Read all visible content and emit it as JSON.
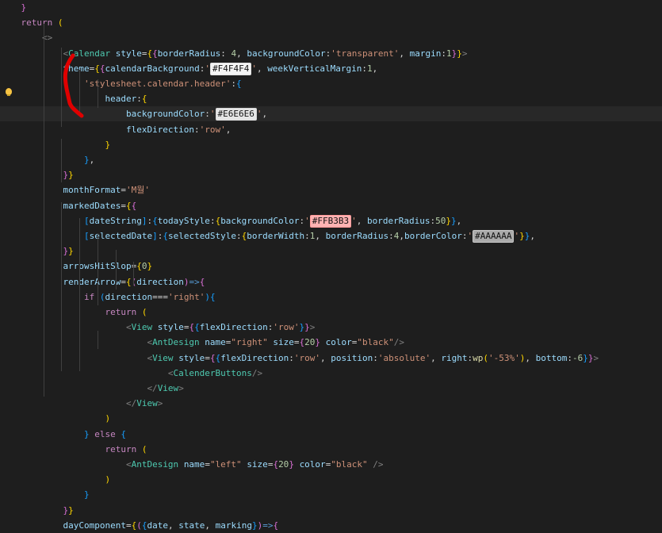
{
  "editor": {
    "lines": [
      [
        {
          "t": "    }",
          "c": "t-p2"
        }
      ],
      [
        {
          "t": "    return ",
          "c": "t-k"
        },
        {
          "t": "(",
          "c": "t-p1"
        }
      ],
      [
        {
          "t": "        ",
          "c": ""
        },
        {
          "t": "<>",
          "c": "t-br"
        }
      ],
      [
        {
          "t": "            ",
          "c": ""
        },
        {
          "t": "<",
          "c": "t-br"
        },
        {
          "t": "Calendar",
          "c": "t-tag"
        },
        {
          "t": " ",
          "c": ""
        },
        {
          "t": "style",
          "c": "t-v"
        },
        {
          "t": "=",
          "c": ""
        },
        {
          "t": "{",
          "c": "t-p1"
        },
        {
          "t": "{",
          "c": "t-p2"
        },
        {
          "t": "borderRadius",
          "c": "t-v"
        },
        {
          "t": ": ",
          "c": ""
        },
        {
          "t": "4",
          "c": "t-n"
        },
        {
          "t": ", ",
          "c": ""
        },
        {
          "t": "backgroundColor",
          "c": "t-v"
        },
        {
          "t": ":",
          "c": ""
        },
        {
          "t": "'transparent'",
          "c": "t-s"
        },
        {
          "t": ", ",
          "c": ""
        },
        {
          "t": "margin",
          "c": "t-v"
        },
        {
          "t": ":",
          "c": ""
        },
        {
          "t": "1",
          "c": "t-n"
        },
        {
          "t": "}",
          "c": "t-p2"
        },
        {
          "t": "}",
          "c": "t-p1"
        },
        {
          "t": ">",
          "c": "t-br"
        }
      ],
      [
        {
          "t": "            ",
          "c": ""
        },
        {
          "t": "theme",
          "c": "t-v"
        },
        {
          "t": "=",
          "c": ""
        },
        {
          "t": "{",
          "c": "t-p1"
        },
        {
          "t": "{",
          "c": "t-p2"
        },
        {
          "t": "calendarBackground",
          "c": "t-v"
        },
        {
          "t": ":",
          "c": ""
        },
        {
          "t": "'",
          "c": "t-s"
        },
        {
          "t": "#F4F4F4",
          "c": "swatch sw-lighter"
        },
        {
          "t": "'",
          "c": "t-s"
        },
        {
          "t": ", ",
          "c": ""
        },
        {
          "t": "weekVerticalMargin",
          "c": "t-v"
        },
        {
          "t": ":",
          "c": ""
        },
        {
          "t": "1",
          "c": "t-n"
        },
        {
          "t": ",",
          "c": ""
        }
      ],
      [
        {
          "t": "                ",
          "c": ""
        },
        {
          "t": "'stylesheet.calendar.header'",
          "c": "t-s"
        },
        {
          "t": ":",
          "c": ""
        },
        {
          "t": "{",
          "c": "t-p3"
        }
      ],
      [
        {
          "t": "                    ",
          "c": ""
        },
        {
          "t": "header",
          "c": "t-v"
        },
        {
          "t": ":",
          "c": ""
        },
        {
          "t": "{",
          "c": "t-p1"
        }
      ],
      [
        {
          "t": "                        ",
          "c": ""
        },
        {
          "t": "backgroundColor",
          "c": "t-v"
        },
        {
          "t": ":",
          "c": ""
        },
        {
          "t": "'",
          "c": "t-s"
        },
        {
          "t": "#E6E6E6",
          "c": "swatch sw-light"
        },
        {
          "t": "'",
          "c": "t-s"
        },
        {
          "t": ",",
          "c": ""
        }
      ],
      [
        {
          "t": "                        ",
          "c": ""
        },
        {
          "t": "flexDirection",
          "c": "t-v"
        },
        {
          "t": ":",
          "c": ""
        },
        {
          "t": "'row'",
          "c": "t-s"
        },
        {
          "t": ",",
          "c": ""
        }
      ],
      [
        {
          "t": "                    ",
          "c": ""
        },
        {
          "t": "}",
          "c": "t-p1"
        }
      ],
      [
        {
          "t": "                ",
          "c": ""
        },
        {
          "t": "}",
          "c": "t-p3"
        },
        {
          "t": ",",
          "c": ""
        }
      ],
      [
        {
          "t": "            ",
          "c": ""
        },
        {
          "t": "}",
          "c": "t-p2"
        },
        {
          "t": "}",
          "c": "t-p1"
        }
      ],
      [
        {
          "t": "            ",
          "c": ""
        },
        {
          "t": "monthFormat",
          "c": "t-v"
        },
        {
          "t": "=",
          "c": ""
        },
        {
          "t": "'M월'",
          "c": "t-s"
        }
      ],
      [
        {
          "t": "            ",
          "c": ""
        },
        {
          "t": "markedDates",
          "c": "t-v"
        },
        {
          "t": "=",
          "c": ""
        },
        {
          "t": "{",
          "c": "t-p1"
        },
        {
          "t": "{",
          "c": "t-p2"
        }
      ],
      [
        {
          "t": "                ",
          "c": ""
        },
        {
          "t": "[",
          "c": "t-p3"
        },
        {
          "t": "dateString",
          "c": "t-v"
        },
        {
          "t": "]",
          "c": "t-p3"
        },
        {
          "t": ":",
          "c": ""
        },
        {
          "t": "{",
          "c": "t-p3"
        },
        {
          "t": "todayStyle",
          "c": "t-v"
        },
        {
          "t": ":",
          "c": ""
        },
        {
          "t": "{",
          "c": "t-p1"
        },
        {
          "t": "backgroundColor",
          "c": "t-v"
        },
        {
          "t": ":",
          "c": ""
        },
        {
          "t": "'",
          "c": "t-s"
        },
        {
          "t": "#FFB3B3",
          "c": "swatch sw-pink"
        },
        {
          "t": "'",
          "c": "t-s"
        },
        {
          "t": ", ",
          "c": ""
        },
        {
          "t": "borderRadius",
          "c": "t-v"
        },
        {
          "t": ":",
          "c": ""
        },
        {
          "t": "50",
          "c": "t-n"
        },
        {
          "t": "}",
          "c": "t-p1"
        },
        {
          "t": "}",
          "c": "t-p3"
        },
        {
          "t": ",",
          "c": ""
        }
      ],
      [
        {
          "t": "                ",
          "c": ""
        },
        {
          "t": "[",
          "c": "t-p3"
        },
        {
          "t": "selectedDate",
          "c": "t-v"
        },
        {
          "t": "]",
          "c": "t-p3"
        },
        {
          "t": ":",
          "c": ""
        },
        {
          "t": "{",
          "c": "t-p3"
        },
        {
          "t": "selectedStyle",
          "c": "t-v"
        },
        {
          "t": ":",
          "c": ""
        },
        {
          "t": "{",
          "c": "t-p1"
        },
        {
          "t": "borderWidth",
          "c": "t-v"
        },
        {
          "t": ":",
          "c": ""
        },
        {
          "t": "1",
          "c": "t-n"
        },
        {
          "t": ", ",
          "c": ""
        },
        {
          "t": "borderRadius",
          "c": "t-v"
        },
        {
          "t": ":",
          "c": ""
        },
        {
          "t": "4",
          "c": "t-n"
        },
        {
          "t": ",",
          "c": ""
        },
        {
          "t": "borderColor",
          "c": "t-v"
        },
        {
          "t": ":",
          "c": ""
        },
        {
          "t": "'",
          "c": "t-s"
        },
        {
          "t": "#AAAAAA",
          "c": "swatch sw-gray"
        },
        {
          "t": "'",
          "c": "t-s"
        },
        {
          "t": "}",
          "c": "t-p1"
        },
        {
          "t": "}",
          "c": "t-p3"
        },
        {
          "t": ",",
          "c": ""
        }
      ],
      [
        {
          "t": "            ",
          "c": ""
        },
        {
          "t": "}",
          "c": "t-p2"
        },
        {
          "t": "}",
          "c": "t-p1"
        }
      ],
      [
        {
          "t": "            ",
          "c": ""
        },
        {
          "t": "arrowsHitSlop",
          "c": "t-v"
        },
        {
          "t": "=",
          "c": ""
        },
        {
          "t": "{",
          "c": "t-p1"
        },
        {
          "t": "0",
          "c": "t-n"
        },
        {
          "t": "}",
          "c": "t-p1"
        }
      ],
      [
        {
          "t": "            ",
          "c": ""
        },
        {
          "t": "renderArrow",
          "c": "t-v"
        },
        {
          "t": "=",
          "c": ""
        },
        {
          "t": "{",
          "c": "t-p1"
        },
        {
          "t": "(",
          "c": "t-p2"
        },
        {
          "t": "direction",
          "c": "t-v"
        },
        {
          "t": ")",
          "c": "t-p2"
        },
        {
          "t": "=>",
          "c": "t-kw"
        },
        {
          "t": "{",
          "c": "t-p2"
        }
      ],
      [
        {
          "t": "                ",
          "c": ""
        },
        {
          "t": "if ",
          "c": "t-k"
        },
        {
          "t": "(",
          "c": "t-p3"
        },
        {
          "t": "direction",
          "c": "t-v"
        },
        {
          "t": "===",
          "c": ""
        },
        {
          "t": "'right'",
          "c": "t-s"
        },
        {
          "t": ")",
          "c": "t-p3"
        },
        {
          "t": "{",
          "c": "t-p3"
        }
      ],
      [
        {
          "t": "                    ",
          "c": ""
        },
        {
          "t": "return ",
          "c": "t-k"
        },
        {
          "t": "(",
          "c": "t-p1"
        }
      ],
      [
        {
          "t": "                        ",
          "c": ""
        },
        {
          "t": "<",
          "c": "t-br"
        },
        {
          "t": "View",
          "c": "t-tag"
        },
        {
          "t": " ",
          "c": ""
        },
        {
          "t": "style",
          "c": "t-v"
        },
        {
          "t": "=",
          "c": ""
        },
        {
          "t": "{",
          "c": "t-p2"
        },
        {
          "t": "{",
          "c": "t-p3"
        },
        {
          "t": "flexDirection",
          "c": "t-v"
        },
        {
          "t": ":",
          "c": ""
        },
        {
          "t": "'row'",
          "c": "t-s"
        },
        {
          "t": "}",
          "c": "t-p3"
        },
        {
          "t": "}",
          "c": "t-p2"
        },
        {
          "t": ">",
          "c": "t-br"
        }
      ],
      [
        {
          "t": "                            ",
          "c": ""
        },
        {
          "t": "<",
          "c": "t-br"
        },
        {
          "t": "AntDesign",
          "c": "t-tag"
        },
        {
          "t": " ",
          "c": ""
        },
        {
          "t": "name",
          "c": "t-v"
        },
        {
          "t": "=",
          "c": ""
        },
        {
          "t": "\"right\"",
          "c": "t-s"
        },
        {
          "t": " ",
          "c": ""
        },
        {
          "t": "size",
          "c": "t-v"
        },
        {
          "t": "=",
          "c": ""
        },
        {
          "t": "{",
          "c": "t-p2"
        },
        {
          "t": "20",
          "c": "t-n"
        },
        {
          "t": "}",
          "c": "t-p2"
        },
        {
          "t": " ",
          "c": ""
        },
        {
          "t": "color",
          "c": "t-v"
        },
        {
          "t": "=",
          "c": ""
        },
        {
          "t": "\"black\"",
          "c": "t-s"
        },
        {
          "t": "/>",
          "c": "t-br"
        }
      ],
      [
        {
          "t": "                            ",
          "c": ""
        },
        {
          "t": "<",
          "c": "t-br"
        },
        {
          "t": "View",
          "c": "t-tag"
        },
        {
          "t": " ",
          "c": ""
        },
        {
          "t": "style",
          "c": "t-v"
        },
        {
          "t": "=",
          "c": ""
        },
        {
          "t": "{",
          "c": "t-p2"
        },
        {
          "t": "{",
          "c": "t-p3"
        },
        {
          "t": "flexDirection",
          "c": "t-v"
        },
        {
          "t": ":",
          "c": ""
        },
        {
          "t": "'row'",
          "c": "t-s"
        },
        {
          "t": ", ",
          "c": ""
        },
        {
          "t": "position",
          "c": "t-v"
        },
        {
          "t": ":",
          "c": ""
        },
        {
          "t": "'absolute'",
          "c": "t-s"
        },
        {
          "t": ", ",
          "c": ""
        },
        {
          "t": "right",
          "c": "t-v"
        },
        {
          "t": ":",
          "c": ""
        },
        {
          "t": "wp",
          "c": "t-f"
        },
        {
          "t": "(",
          "c": "t-p1"
        },
        {
          "t": "'-53%'",
          "c": "t-s"
        },
        {
          "t": ")",
          "c": "t-p1"
        },
        {
          "t": ", ",
          "c": ""
        },
        {
          "t": "bottom",
          "c": "t-v"
        },
        {
          "t": ":",
          "c": ""
        },
        {
          "t": "-6",
          "c": "t-n"
        },
        {
          "t": "}",
          "c": "t-p3"
        },
        {
          "t": "}",
          "c": "t-p2"
        },
        {
          "t": ">",
          "c": "t-br"
        }
      ],
      [
        {
          "t": "                                ",
          "c": ""
        },
        {
          "t": "<",
          "c": "t-br"
        },
        {
          "t": "CalenderButtons",
          "c": "t-tag"
        },
        {
          "t": "/>",
          "c": "t-br"
        }
      ],
      [
        {
          "t": "                            ",
          "c": ""
        },
        {
          "t": "</",
          "c": "t-br"
        },
        {
          "t": "View",
          "c": "t-tag"
        },
        {
          "t": ">",
          "c": "t-br"
        }
      ],
      [
        {
          "t": "                        ",
          "c": ""
        },
        {
          "t": "</",
          "c": "t-br"
        },
        {
          "t": "View",
          "c": "t-tag"
        },
        {
          "t": ">",
          "c": "t-br"
        }
      ],
      [
        {
          "t": "                    ",
          "c": ""
        },
        {
          "t": ")",
          "c": "t-p1"
        }
      ],
      [
        {
          "t": "                ",
          "c": ""
        },
        {
          "t": "}",
          "c": "t-p3"
        },
        {
          "t": " else ",
          "c": "t-k"
        },
        {
          "t": "{",
          "c": "t-p3"
        }
      ],
      [
        {
          "t": "                    ",
          "c": ""
        },
        {
          "t": "return ",
          "c": "t-k"
        },
        {
          "t": "(",
          "c": "t-p1"
        }
      ],
      [
        {
          "t": "                        ",
          "c": ""
        },
        {
          "t": "<",
          "c": "t-br"
        },
        {
          "t": "AntDesign",
          "c": "t-tag"
        },
        {
          "t": " ",
          "c": ""
        },
        {
          "t": "name",
          "c": "t-v"
        },
        {
          "t": "=",
          "c": ""
        },
        {
          "t": "\"left\"",
          "c": "t-s"
        },
        {
          "t": " ",
          "c": ""
        },
        {
          "t": "size",
          "c": "t-v"
        },
        {
          "t": "=",
          "c": ""
        },
        {
          "t": "{",
          "c": "t-p2"
        },
        {
          "t": "20",
          "c": "t-n"
        },
        {
          "t": "}",
          "c": "t-p2"
        },
        {
          "t": " ",
          "c": ""
        },
        {
          "t": "color",
          "c": "t-v"
        },
        {
          "t": "=",
          "c": ""
        },
        {
          "t": "\"black\"",
          "c": "t-s"
        },
        {
          "t": " ",
          "c": ""
        },
        {
          "t": "/>",
          "c": "t-br"
        }
      ],
      [
        {
          "t": "                    ",
          "c": ""
        },
        {
          "t": ")",
          "c": "t-p1"
        }
      ],
      [
        {
          "t": "                ",
          "c": ""
        },
        {
          "t": "}",
          "c": "t-p3"
        }
      ],
      [
        {
          "t": "            ",
          "c": ""
        },
        {
          "t": "}",
          "c": "t-p2"
        },
        {
          "t": "}",
          "c": "t-p1"
        }
      ],
      [
        {
          "t": "            ",
          "c": ""
        },
        {
          "t": "dayComponent",
          "c": "t-v"
        },
        {
          "t": "=",
          "c": ""
        },
        {
          "t": "{",
          "c": "t-p1"
        },
        {
          "t": "(",
          "c": "t-p2"
        },
        {
          "t": "{",
          "c": "t-p3"
        },
        {
          "t": "date",
          "c": "t-v"
        },
        {
          "t": ", ",
          "c": ""
        },
        {
          "t": "state",
          "c": "t-v"
        },
        {
          "t": ", ",
          "c": ""
        },
        {
          "t": "marking",
          "c": "t-v"
        },
        {
          "t": "}",
          "c": "t-p3"
        },
        {
          "t": ")",
          "c": "t-p2"
        },
        {
          "t": "=>",
          "c": "t-kw"
        },
        {
          "t": "{",
          "c": "t-p2"
        }
      ]
    ]
  },
  "colors": {
    "background": "#1e1e1e",
    "annotation": "#e00000",
    "lightbulb": "#f6c343"
  },
  "icons": [
    "lightbulb-icon"
  ]
}
